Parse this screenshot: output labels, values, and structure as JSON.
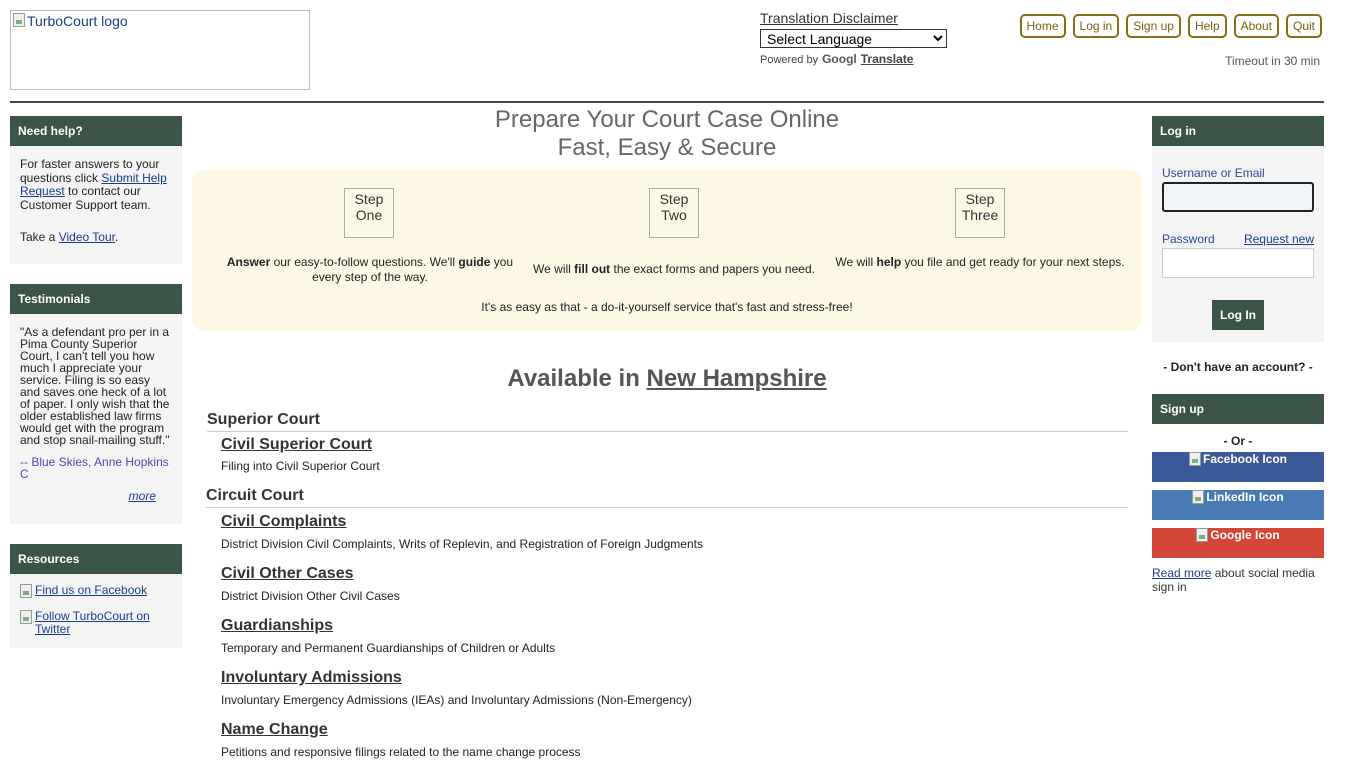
{
  "header": {
    "logo_alt": "TurboCourt logo",
    "translation_disclaimer": "Translation Disclaimer",
    "language_select": "Select Language",
    "powered_by": "Powered by",
    "google": "Googl",
    "translate": "Translate",
    "nav": [
      "Home",
      "Log in",
      "Sign up",
      "Help",
      "About",
      "Quit"
    ],
    "timeout": "Timeout in 30 min"
  },
  "left": {
    "help": {
      "title": "Need help?",
      "text1": "For faster answers to your questions click",
      "link": "Submit Help Request",
      "text2": "to contact our Customer Support team.",
      "tour_prefix": "Take a",
      "tour_link": "Video Tour",
      "tour_suffix": "."
    },
    "testimonials": {
      "title": "Testimonials",
      "quote": "\"As a defendant pro per in a Pima County Superior Court, I can't tell you how much I appreciate your service. Filing is so easy and saves one heck of a lot of paper. I only wish that the older established law firms would get with the program and stop snail-mailing stuff.\"",
      "author": "-- Blue Skies, Anne Hopkins C",
      "more": "more"
    },
    "resources": {
      "title": "Resources",
      "facebook": "Find us on Facebook",
      "twitter": "Follow TurboCourt on Twitter"
    }
  },
  "main": {
    "headline1": "Prepare Your Court Case Online",
    "headline2": "Fast, Easy & Secure",
    "steps": [
      {
        "img": "Step One",
        "b1": "Answer",
        "t1": " our easy-to-follow questions. We'll ",
        "b2": "guide",
        "t2": " you every step of the way."
      },
      {
        "img": "Step Two",
        "t0": "We will ",
        "b1": "fill out",
        "t1": " the exact forms and papers you need."
      },
      {
        "img": "Step Three",
        "t0": "We will ",
        "b1": "help",
        "t1": " you file and get ready for your next steps."
      }
    ],
    "tagline": "It's as easy as that - a do-it-yourself service that's fast and stress-free!",
    "available_prefix": "Available in",
    "state": "New Hampshire",
    "courts": [
      {
        "name": "Superior Court",
        "cases": [
          {
            "title": "Civil Superior Court",
            "desc": "Filing into Civil Superior Court"
          }
        ]
      },
      {
        "name": "Circuit Court",
        "cases": [
          {
            "title": "Civil Complaints",
            "desc": "District Division Civil Complaints, Writs of Replevin, and Registration of Foreign Judgments"
          },
          {
            "title": "Civil Other Cases",
            "desc": "District Division Other Civil Cases"
          },
          {
            "title": "Guardianships",
            "desc": "Temporary and Permanent Guardianships of Children or Adults"
          },
          {
            "title": "Involuntary Admissions",
            "desc": "Involuntary Emergency Admissions (IEAs) and Involuntary Admissions (Non-Emergency)"
          },
          {
            "title": "Name Change",
            "desc": "Petitions and responsive filings related to the name change process"
          }
        ]
      }
    ]
  },
  "right": {
    "login": {
      "title": "Log in",
      "username_label": "Username or Email",
      "password_label": "Password",
      "request_new": "Request new",
      "button": "Log In"
    },
    "no_account": "- Don't have an account? -",
    "signup_title": "Sign up",
    "or": "- Or -",
    "facebook": "Facebook Icon",
    "linkedin": "LinkedIn Icon",
    "google": "Google Icon",
    "read_more": "Read more",
    "read_more_suffix": " about social media sign in"
  },
  "colors": {
    "panel_header": "#3a5546",
    "nav_border": "#8a6d1a",
    "steps_bg": "#fcf8e4",
    "facebook": "#3b5998",
    "linkedin": "#4a7ab5",
    "google": "#d44638"
  }
}
